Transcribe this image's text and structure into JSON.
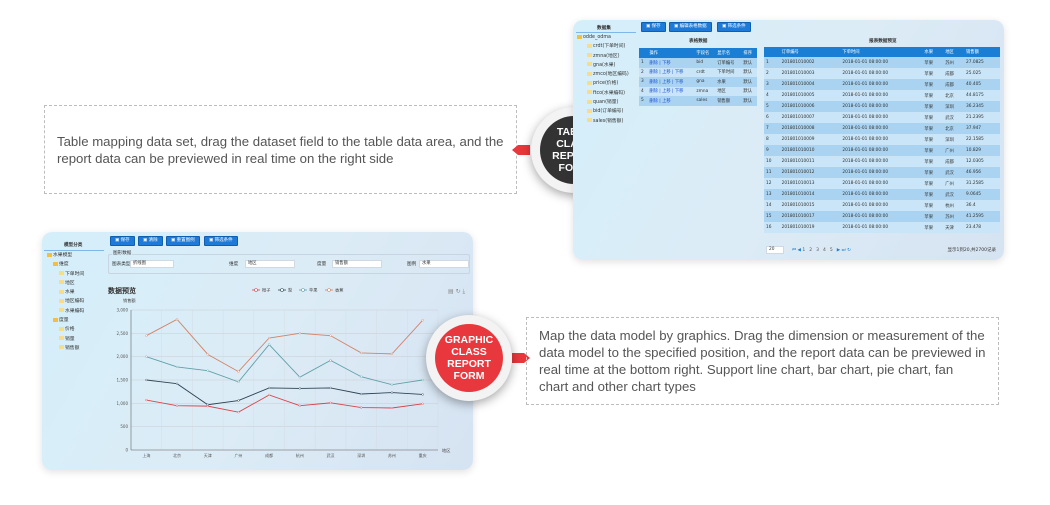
{
  "callouts": {
    "table": {
      "text": "Table mapping data set, drag the dataset field to the table data area, and the report data can be previewed in real time on the right side",
      "badge": [
        "TABLE",
        "CLASS",
        "REPORT",
        "FORM"
      ],
      "color": "#333333"
    },
    "graphic": {
      "text": "Map the data model by graphics. Drag the dimension or measurement of the data model to the specified position, and the report data can be previewed in real time at the bottom right. Support line chart, bar chart, pie chart, fan chart and other chart types",
      "badge": [
        "GRAPHIC",
        "CLASS",
        "REPORT",
        "FORM"
      ],
      "color": "#e8383d"
    }
  },
  "table_shot": {
    "tree_title": "数据集",
    "tree_root": "odde_odma",
    "tree_items": [
      "crdt(下单时间)",
      "zmna(地区)",
      "gna(水果)",
      "zmco(地区编码)",
      "price(价格)",
      "ftco(水果编码)",
      "quan(销量)",
      "bid(订单编号)",
      "sales(销售额)"
    ],
    "toolbar": [
      "保存",
      "编辑表格数据",
      "筛选条件"
    ],
    "mapping_title": "表格数据",
    "mapping_headers": [
      "",
      "操作",
      "字段名",
      "显示名",
      "排序"
    ],
    "mapping_rows": [
      [
        "1",
        "删除 | 下移",
        "bid",
        "订单编号",
        "默认"
      ],
      [
        "2",
        "删除 | 上移 | 下移",
        "crdt",
        "下单时间",
        "默认"
      ],
      [
        "3",
        "删除 | 上移 | 下移",
        "gna",
        "水果",
        "默认"
      ],
      [
        "4",
        "删除 | 上移 | 下移",
        "zmna",
        "地区",
        "默认"
      ],
      [
        "5",
        "删除 | 上移",
        "sales",
        "销售额",
        "默认"
      ]
    ],
    "preview_title": "报表数据预览",
    "preview_headers": [
      "",
      "订单编号",
      "下单时间",
      "水果",
      "地区",
      "销售额"
    ],
    "preview_rows": [
      [
        "1",
        "201801010002",
        "2018-01-01 08:00:00",
        "苹果",
        "苏州",
        "27.0825"
      ],
      [
        "2",
        "201801010003",
        "2018-01-01 08:00:00",
        "苹果",
        "成都",
        "25.025"
      ],
      [
        "3",
        "201801010004",
        "2018-01-01 08:00:00",
        "苹果",
        "成都",
        "40.405"
      ],
      [
        "4",
        "201801010005",
        "2018-01-01 08:00:00",
        "苹果",
        "北京",
        "44.8175"
      ],
      [
        "5",
        "201801010006",
        "2018-01-01 08:00:00",
        "苹果",
        "深圳",
        "36.2345"
      ],
      [
        "6",
        "201801010007",
        "2018-01-01 08:00:00",
        "苹果",
        "武汉",
        "21.2395"
      ],
      [
        "7",
        "201801010008",
        "2018-01-01 08:00:00",
        "苹果",
        "北京",
        "37.947"
      ],
      [
        "8",
        "201801010009",
        "2018-01-01 08:00:00",
        "苹果",
        "深圳",
        "22.1585"
      ],
      [
        "9",
        "201801010010",
        "2018-01-01 08:00:00",
        "苹果",
        "广州",
        "10.829"
      ],
      [
        "10",
        "201801010011",
        "2018-01-01 08:00:00",
        "苹果",
        "成都",
        "12.0305"
      ],
      [
        "11",
        "201801010012",
        "2018-01-01 08:00:00",
        "苹果",
        "武汉",
        "46.956"
      ],
      [
        "12",
        "201801010013",
        "2018-01-01 08:00:00",
        "苹果",
        "广州",
        "31.2585"
      ],
      [
        "13",
        "201801010014",
        "2018-01-01 08:00:00",
        "苹果",
        "武汉",
        "9.0645"
      ],
      [
        "14",
        "201801010015",
        "2018-01-01 08:00:00",
        "苹果",
        "杭州",
        "36.4"
      ],
      [
        "15",
        "201801010017",
        "2018-01-01 08:00:00",
        "苹果",
        "苏州",
        "41.2595"
      ],
      [
        "16",
        "201801010019",
        "2018-01-01 08:00:00",
        "苹果",
        "天津",
        "23.478"
      ]
    ],
    "page_size": "20",
    "pages": [
      "1",
      "2",
      "3",
      "4",
      "5"
    ],
    "page_info": "显示1到20,共2700记录"
  },
  "chart_shot": {
    "tree_title": "模型分类",
    "tree": [
      [
        "水果模型",
        0
      ],
      [
        "维度",
        1
      ],
      [
        "下单时间",
        2
      ],
      [
        "地区",
        2
      ],
      [
        "水果",
        2
      ],
      [
        "地区编码",
        2
      ],
      [
        "水果编码",
        2
      ],
      [
        "度量",
        1
      ],
      [
        "价格",
        2
      ],
      [
        "销量",
        2
      ],
      [
        "销售额",
        2
      ]
    ],
    "toolbar": [
      "保存",
      "清除",
      "重置图例",
      "筛选条件"
    ],
    "fieldset_title": "图形数据",
    "fields": [
      {
        "label": "图表类型",
        "value": "折线图"
      },
      {
        "label": "维度",
        "value": "地区"
      },
      {
        "label": "度量",
        "value": "销售额"
      },
      {
        "label": "图例",
        "value": "水果"
      }
    ]
  },
  "chart_data": {
    "type": "line",
    "title": "数据预览",
    "xlabel": "地区",
    "ylabel": "销售额",
    "ylim": [
      0,
      3000
    ],
    "yticks": [
      "0",
      "500",
      "1,000",
      "1,500",
      "2,000",
      "2,500",
      "3,000"
    ],
    "grid": true,
    "legend": "top-center",
    "categories": [
      "上海",
      "北京",
      "天津",
      "广州",
      "成都",
      "杭州",
      "武汉",
      "深圳",
      "苏州",
      "重庆"
    ],
    "series": [
      {
        "name": "橙子",
        "color": "#d9434a",
        "values": [
          1070,
          950,
          940,
          810,
          1180,
          950,
          1010,
          910,
          900,
          990
        ]
      },
      {
        "name": "梨",
        "color": "#2f4554",
        "values": [
          1500,
          1420,
          970,
          1060,
          1330,
          1320,
          1330,
          1200,
          1230,
          1190
        ]
      },
      {
        "name": "苹果",
        "color": "#61a0a8",
        "values": [
          2000,
          1780,
          1700,
          1460,
          2260,
          1560,
          1920,
          1570,
          1400,
          1500
        ]
      },
      {
        "name": "香蕉",
        "color": "#d48265",
        "values": [
          2450,
          2800,
          2050,
          1680,
          2400,
          2500,
          2450,
          2080,
          2060,
          2780
        ]
      }
    ]
  }
}
